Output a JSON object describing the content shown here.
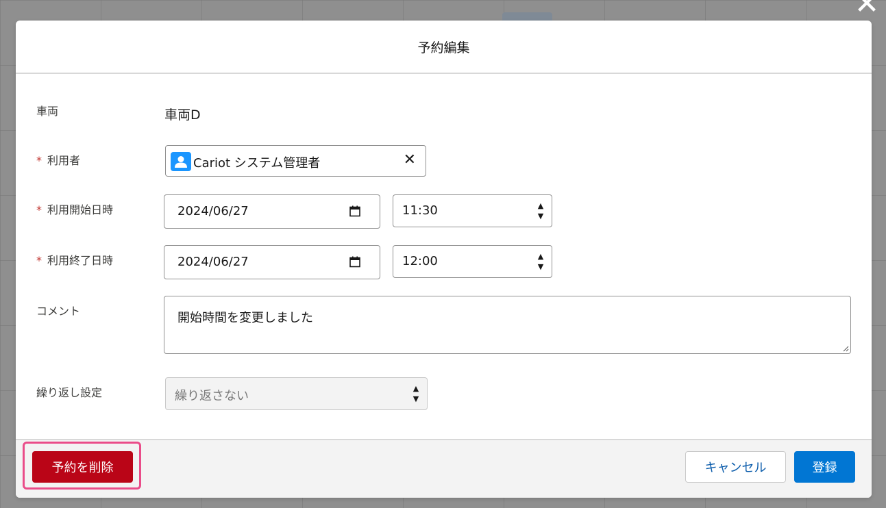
{
  "modal": {
    "title": "予約編集"
  },
  "form": {
    "required_mark": "*",
    "vehicle": {
      "label": "車両",
      "value": "車両D"
    },
    "user": {
      "label": "利用者",
      "value": "Cariot システム管理者",
      "clear_glyph": "✕",
      "icon": "user-avatar-icon"
    },
    "start": {
      "label": "利用開始日時",
      "date": "2024/06/27",
      "time": "11:30"
    },
    "end": {
      "label": "利用終了日時",
      "date": "2024/06/27",
      "time": "12:00"
    },
    "comment": {
      "label": "コメント",
      "value": "開始時間を変更しました"
    },
    "repeat": {
      "label": "繰り返し設定",
      "value": "繰り返さない"
    }
  },
  "footer": {
    "delete_label": "予約を削除",
    "cancel_label": "キャンセル",
    "save_label": "登録"
  },
  "colors": {
    "delete": "#ba0517",
    "primary": "#0176d3",
    "highlight": "#ea4c89",
    "required": "#c23934",
    "avatar": "#1b96ff"
  },
  "icons": {
    "close": "✕",
    "spin_up": "▲",
    "spin_down": "▼"
  }
}
